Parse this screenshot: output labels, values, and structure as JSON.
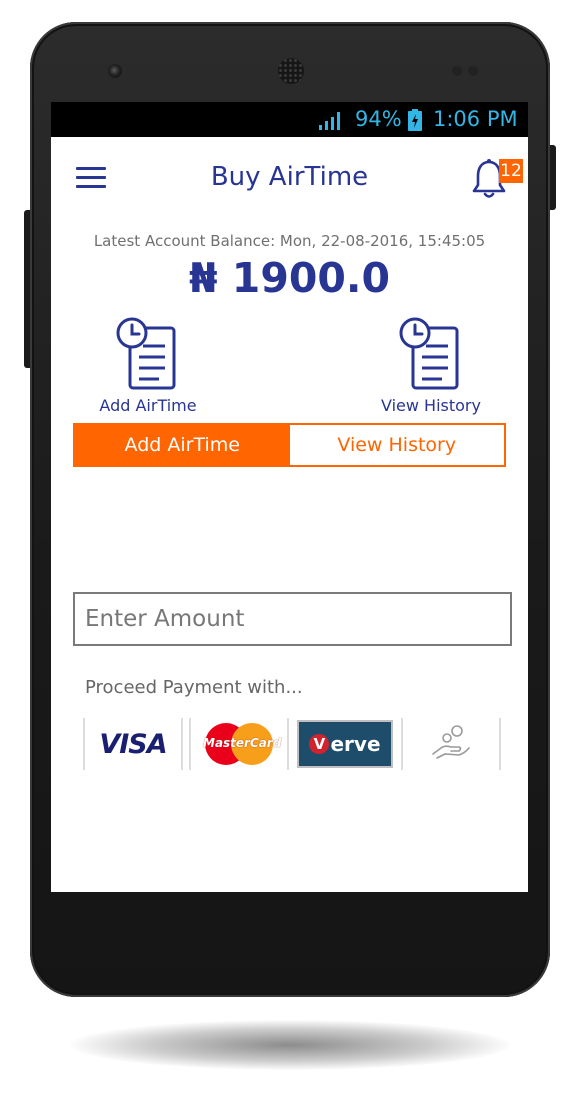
{
  "status_bar": {
    "battery": "94%",
    "time": "1:06 PM"
  },
  "header": {
    "title": "Buy AirTime",
    "notification_count": "12"
  },
  "balance": {
    "label": "Latest Account Balance: Mon, 22-08-2016, 15:45:05",
    "amount": "₦ 1900.0"
  },
  "shortcuts": [
    {
      "label": "Add AirTime"
    },
    {
      "label": "View History"
    }
  ],
  "tabs": [
    {
      "label": "Add AirTime",
      "active": true
    },
    {
      "label": "View History",
      "active": false
    }
  ],
  "amount_field": {
    "placeholder": "Enter Amount",
    "value": ""
  },
  "payment": {
    "label": "Proceed Payment with...",
    "methods": [
      {
        "name": "VISA"
      },
      {
        "name": "MasterCard"
      },
      {
        "name_a": "V",
        "name_b": "erve"
      },
      {
        "icon": "hand-coins-icon"
      }
    ]
  },
  "colors": {
    "accent": "#ff6500",
    "primary": "#283593",
    "statusbar_text": "#33b5e5"
  }
}
